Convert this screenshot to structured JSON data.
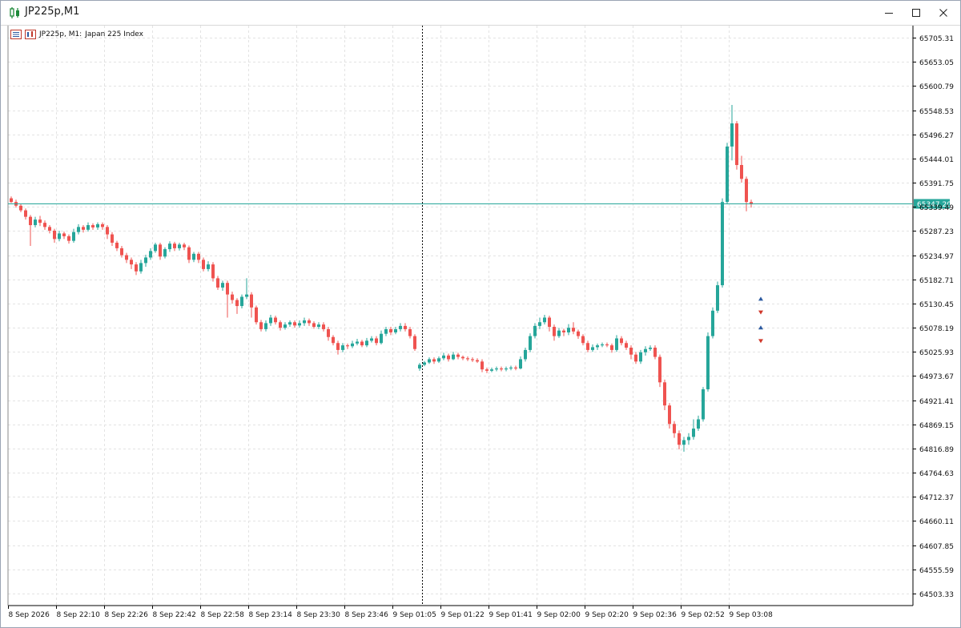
{
  "window": {
    "title": "JP225p,M1",
    "minimize_icon": "minimize-icon",
    "maximize_icon": "maximize-icon",
    "close_icon": "close-icon"
  },
  "chart_info": {
    "symbol_tf": "JP225p, M1:",
    "description": "Japan 225 Index"
  },
  "colors": {
    "bull": "#26a69a",
    "bear": "#ef5350",
    "grid": "#e3e3e3",
    "price_line": "#26a69a",
    "price_label_bg": "#26a69a",
    "crosshair": "#000000"
  },
  "chart_data": {
    "type": "candlestick",
    "symbol": "JP225p",
    "timeframe": "M1",
    "y_ticks": [
      "65705.31",
      "65653.05",
      "65600.79",
      "65548.53",
      "65496.27",
      "65444.01",
      "65391.75",
      "65339.49",
      "65287.23",
      "65234.97",
      "65182.71",
      "65130.45",
      "65078.19",
      "65025.93",
      "64973.67",
      "64921.41",
      "64869.15",
      "64816.89",
      "64764.63",
      "64712.37",
      "64660.11",
      "64607.85",
      "64555.59",
      "64503.33"
    ],
    "y_range": [
      64477.2,
      65731.44
    ],
    "x_ticks": [
      "8 Sep 2026",
      "8 Sep 22:10",
      "8 Sep 22:26",
      "8 Sep 22:42",
      "8 Sep 22:58",
      "8 Sep 23:14",
      "8 Sep 23:30",
      "8 Sep 23:46",
      "9 Sep 01:05",
      "9 Sep 01:22",
      "9 Sep 01:41",
      "9 Sep 02:00",
      "9 Sep 02:20",
      "9 Sep 02:36",
      "9 Sep 02:52",
      "9 Sep 03:08"
    ],
    "current_price": "65347.20",
    "current_price_value": 65347.2,
    "candles": [
      [
        65358,
        65350,
        65362,
        65348
      ],
      [
        65350,
        65342,
        65355,
        65338
      ],
      [
        65342,
        65332,
        65346,
        65328
      ],
      [
        65332,
        65318,
        65336,
        65312
      ],
      [
        65318,
        65300,
        65322,
        65255
      ],
      [
        65300,
        65312,
        65318,
        65295
      ],
      [
        65312,
        65305,
        65320,
        65298
      ],
      [
        65305,
        65296,
        65310,
        65290
      ],
      [
        65296,
        65288,
        65300,
        65282
      ],
      [
        65288,
        65270,
        65292,
        65262
      ],
      [
        65270,
        65282,
        65288,
        65265
      ],
      [
        65282,
        65276,
        65286,
        65270
      ],
      [
        65276,
        65266,
        65280,
        65260
      ],
      [
        65266,
        65285,
        65292,
        65262
      ],
      [
        65285,
        65296,
        65302,
        65280
      ],
      [
        65296,
        65290,
        65300,
        65284
      ],
      [
        65290,
        65300,
        65306,
        65286
      ],
      [
        65300,
        65295,
        65304,
        65290
      ],
      [
        65295,
        65302,
        65306,
        65290
      ],
      [
        65302,
        65296,
        65306,
        65290
      ],
      [
        65296,
        65280,
        65300,
        65270
      ],
      [
        65280,
        65262,
        65285,
        65255
      ],
      [
        65262,
        65250,
        65266,
        65244
      ],
      [
        65250,
        65235,
        65255,
        65230
      ],
      [
        65235,
        65225,
        65240,
        65218
      ],
      [
        65225,
        65215,
        65230,
        65205
      ],
      [
        65215,
        65200,
        65220,
        65192
      ],
      [
        65200,
        65218,
        65225,
        65195
      ],
      [
        65218,
        65230,
        65236,
        65210
      ],
      [
        65230,
        65244,
        65250,
        65225
      ],
      [
        65244,
        65258,
        65262,
        65240
      ],
      [
        65258,
        65232,
        65262,
        65225
      ],
      [
        65232,
        65248,
        65252,
        65228
      ],
      [
        65248,
        65260,
        65265,
        65242
      ],
      [
        65260,
        65250,
        65264,
        65244
      ],
      [
        65250,
        65258,
        65262,
        65245
      ],
      [
        65258,
        65252,
        65262,
        65246
      ],
      [
        65252,
        65225,
        65256,
        65218
      ],
      [
        65225,
        65238,
        65242,
        65220
      ],
      [
        65238,
        65225,
        65242,
        65218
      ],
      [
        65225,
        65205,
        65230,
        65200
      ],
      [
        65205,
        65215,
        65222,
        65200
      ],
      [
        65215,
        65185,
        65220,
        65178
      ],
      [
        65185,
        65165,
        65190,
        65160
      ],
      [
        65165,
        65175,
        65180,
        65158
      ],
      [
        65175,
        65150,
        65180,
        65100
      ],
      [
        65150,
        65138,
        65156,
        65130
      ],
      [
        65138,
        65125,
        65142,
        65108
      ],
      [
        65125,
        65145,
        65150,
        65120
      ],
      [
        65145,
        65150,
        65185,
        65140
      ],
      [
        65150,
        65122,
        65155,
        65100
      ],
      [
        65122,
        65090,
        65126,
        65085
      ],
      [
        65090,
        65075,
        65095,
        65070
      ],
      [
        65075,
        65088,
        65094,
        65070
      ],
      [
        65088,
        65100,
        65106,
        65082
      ],
      [
        65100,
        65090,
        65104,
        65085
      ],
      [
        65090,
        65078,
        65094,
        65072
      ],
      [
        65078,
        65085,
        65090,
        65074
      ],
      [
        65085,
        65090,
        65094,
        65080
      ],
      [
        65090,
        65083,
        65094,
        65078
      ],
      [
        65083,
        65088,
        65094,
        65078
      ],
      [
        65088,
        65094,
        65100,
        65082
      ],
      [
        65094,
        65088,
        65098,
        65082
      ],
      [
        65088,
        65080,
        65092,
        65076
      ],
      [
        65080,
        65085,
        65090,
        65075
      ],
      [
        65085,
        65075,
        65090,
        65070
      ],
      [
        65075,
        65058,
        65080,
        65050
      ],
      [
        65058,
        65045,
        65062,
        65040
      ],
      [
        65045,
        65030,
        65050,
        65020
      ],
      [
        65030,
        65040,
        65045,
        65025
      ],
      [
        65040,
        65038,
        65044,
        65032
      ],
      [
        65038,
        65044,
        65050,
        65034
      ],
      [
        65044,
        65048,
        65054,
        65040
      ],
      [
        65048,
        65040,
        65052,
        65036
      ],
      [
        65040,
        65050,
        65056,
        65036
      ],
      [
        65050,
        65055,
        65060,
        65046
      ],
      [
        65055,
        65045,
        65060,
        65040
      ],
      [
        65045,
        65065,
        65072,
        65042
      ],
      [
        65065,
        65075,
        65080,
        65060
      ],
      [
        65075,
        65068,
        65080,
        65062
      ],
      [
        65068,
        65075,
        65080,
        65064
      ],
      [
        65075,
        65082,
        65088,
        65070
      ],
      [
        65082,
        65075,
        65088,
        65070
      ],
      [
        65075,
        65060,
        65080,
        65055
      ],
      [
        65060,
        65032,
        65064,
        65028
      ],
      [
        64990,
        64998,
        65002,
        64985
      ],
      [
        64998,
        65003,
        65006,
        64995
      ],
      [
        65003,
        65010,
        65014,
        65000
      ],
      [
        65010,
        65005,
        65014,
        65000
      ],
      [
        65005,
        65012,
        65016,
        65002
      ],
      [
        65012,
        65018,
        65024,
        65008
      ],
      [
        65018,
        65010,
        65022,
        65005
      ],
      [
        65010,
        65020,
        65026,
        65008
      ],
      [
        65020,
        65015,
        65024,
        65010
      ],
      [
        65015,
        65012,
        65018,
        65008
      ],
      [
        65012,
        65010,
        65016,
        65006
      ],
      [
        65010,
        65008,
        65014,
        65004
      ],
      [
        65008,
        65005,
        65012,
        65002
      ],
      [
        65005,
        64988,
        65010,
        64982
      ],
      [
        64988,
        64985,
        64992,
        64980
      ],
      [
        64985,
        64988,
        64992,
        64982
      ],
      [
        64988,
        64990,
        64994,
        64984
      ],
      [
        64990,
        64988,
        64994,
        64984
      ],
      [
        64988,
        64990,
        64994,
        64984
      ],
      [
        64990,
        64992,
        64996,
        64986
      ],
      [
        64992,
        64990,
        64996,
        64986
      ],
      [
        64990,
        65010,
        65016,
        64988
      ],
      [
        65010,
        65030,
        65035,
        65005
      ],
      [
        65030,
        65060,
        65066,
        65025
      ],
      [
        65060,
        65082,
        65088,
        65055
      ],
      [
        65082,
        65090,
        65100,
        65075
      ],
      [
        65090,
        65100,
        65106,
        65085
      ],
      [
        65100,
        65080,
        65104,
        65070
      ],
      [
        65080,
        65060,
        65085,
        65050
      ],
      [
        65060,
        65072,
        65078,
        65056
      ],
      [
        65072,
        65068,
        65076,
        65060
      ],
      [
        65068,
        65078,
        65086,
        65062
      ],
      [
        65078,
        65070,
        65090,
        65064
      ],
      [
        65070,
        65060,
        65074,
        65054
      ],
      [
        65060,
        65045,
        65064,
        65040
      ],
      [
        65045,
        65030,
        65050,
        65025
      ],
      [
        65030,
        65036,
        65042,
        65026
      ],
      [
        65036,
        65040,
        65044,
        65030
      ],
      [
        65040,
        65042,
        65046,
        65036
      ],
      [
        65042,
        65040,
        65046,
        65036
      ],
      [
        65040,
        65030,
        65044,
        65024
      ],
      [
        65030,
        65055,
        65062,
        65026
      ],
      [
        65055,
        65045,
        65060,
        65040
      ],
      [
        65045,
        65035,
        65050,
        65030
      ],
      [
        65035,
        65020,
        65040,
        65010
      ],
      [
        65020,
        65005,
        65026,
        65000
      ],
      [
        65005,
        65025,
        65030,
        65000
      ],
      [
        65025,
        65032,
        65038,
        65018
      ],
      [
        65032,
        65035,
        65040,
        65028
      ],
      [
        65035,
        65015,
        65040,
        65010
      ],
      [
        65015,
        64960,
        65020,
        64950
      ],
      [
        64960,
        64910,
        64966,
        64900
      ],
      [
        64910,
        64870,
        64915,
        64860
      ],
      [
        64870,
        64850,
        64876,
        64840
      ],
      [
        64850,
        64825,
        64856,
        64815
      ],
      [
        64825,
        64835,
        64842,
        64810
      ],
      [
        64835,
        64842,
        64850,
        64825
      ],
      [
        64842,
        64860,
        64880,
        64836
      ],
      [
        64860,
        64880,
        64888,
        64855
      ],
      [
        64880,
        64945,
        64950,
        64875
      ],
      [
        64945,
        65060,
        65068,
        64940
      ],
      [
        65060,
        65115,
        65122,
        65055
      ],
      [
        65115,
        65170,
        65178,
        65110
      ],
      [
        65170,
        65350,
        65358,
        65165
      ],
      [
        65350,
        65470,
        65478,
        65345
      ],
      [
        65470,
        65520,
        65560,
        65440
      ],
      [
        65520,
        65430,
        65525,
        65420
      ],
      [
        65430,
        65400,
        65450,
        65392
      ],
      [
        65400,
        65350,
        65405,
        65330
      ],
      [
        65350,
        65345,
        65355,
        65338
      ]
    ],
    "markers": [
      {
        "candle": 156,
        "price": 65140,
        "type": "buy"
      },
      {
        "candle": 156,
        "price": 65112,
        "type": "sell"
      },
      {
        "candle": 156,
        "price": 65078,
        "type": "buy"
      },
      {
        "candle": 156,
        "price": 65050,
        "type": "sell"
      }
    ],
    "vline_time": "9 Sep 01:05",
    "grid": true
  }
}
